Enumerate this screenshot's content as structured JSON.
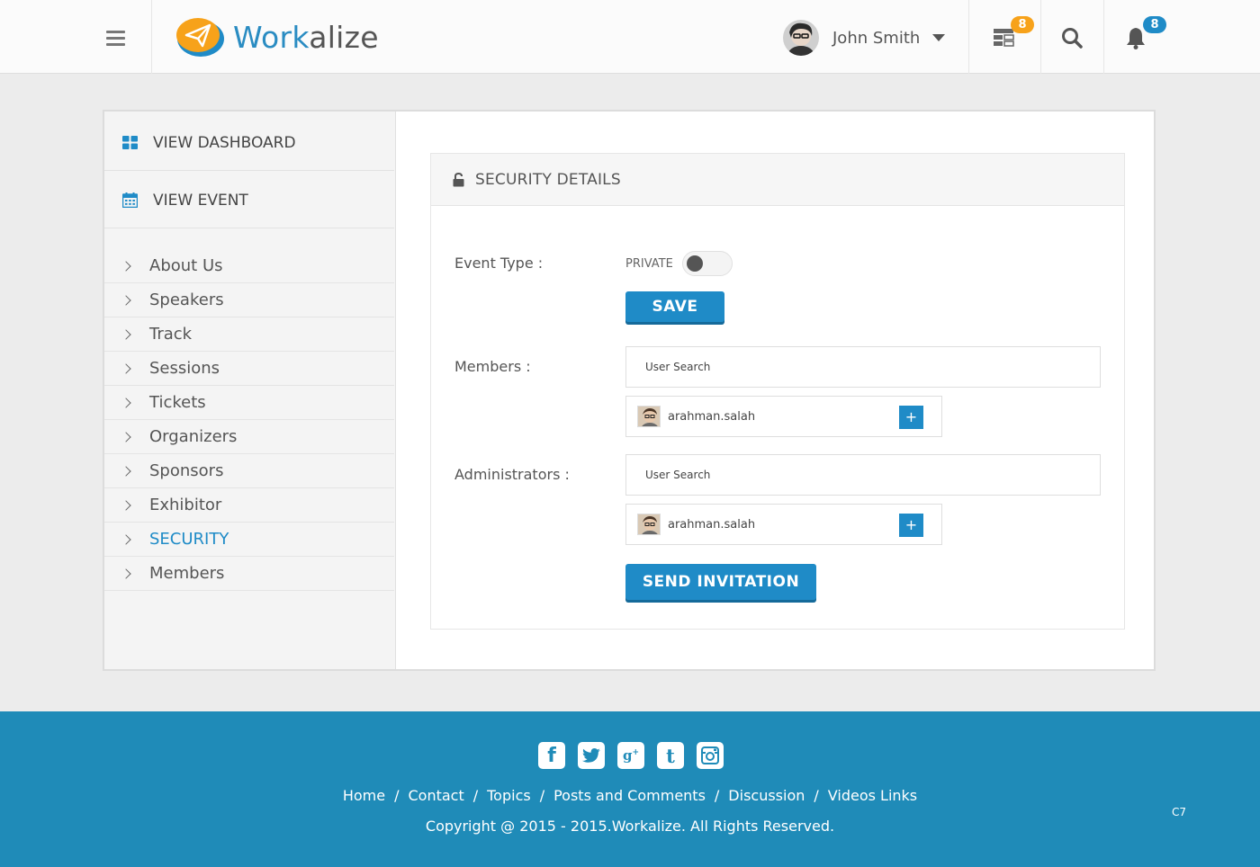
{
  "header": {
    "logo_part1": "Work",
    "logo_part2": "alize",
    "user_name": "John Smith",
    "tasks_badge": "8",
    "notifications_badge": "8"
  },
  "sidebar": {
    "dashboard_label": "VIEW DASHBOARD",
    "event_label": "VIEW EVENT",
    "items": [
      {
        "label": "About Us"
      },
      {
        "label": "Speakers"
      },
      {
        "label": "Track"
      },
      {
        "label": "Sessions"
      },
      {
        "label": "Tickets"
      },
      {
        "label": "Organizers"
      },
      {
        "label": "Sponsors"
      },
      {
        "label": "Exhibitor"
      },
      {
        "label": "SECURITY"
      },
      {
        "label": "Members"
      }
    ]
  },
  "panel": {
    "title": "SECURITY DETAILS",
    "event_type_label": "Event Type :",
    "toggle_label": "PRIVATE",
    "save_label": "SAVE",
    "members_label": "Members :",
    "members_search_placeholder": "User Search",
    "members_user": "arahman.salah",
    "admins_label": "Administrators :",
    "admins_search_placeholder": "User Search",
    "admins_user": "arahman.salah",
    "add_symbol": "+",
    "send_label": "SEND INVITATION"
  },
  "footer": {
    "links": [
      "Home",
      "Contact",
      "Topics",
      "Posts and Comments",
      "Discussion",
      "Videos Links"
    ],
    "separator": "/",
    "copyright": "Copyright @ 2015 - 2015.Workalize. All Rights Reserved.",
    "code": "C7"
  },
  "colors": {
    "accent": "#1f8bc7",
    "footer_bg": "#1f8bb8",
    "badge_orange": "#f7a21a"
  }
}
